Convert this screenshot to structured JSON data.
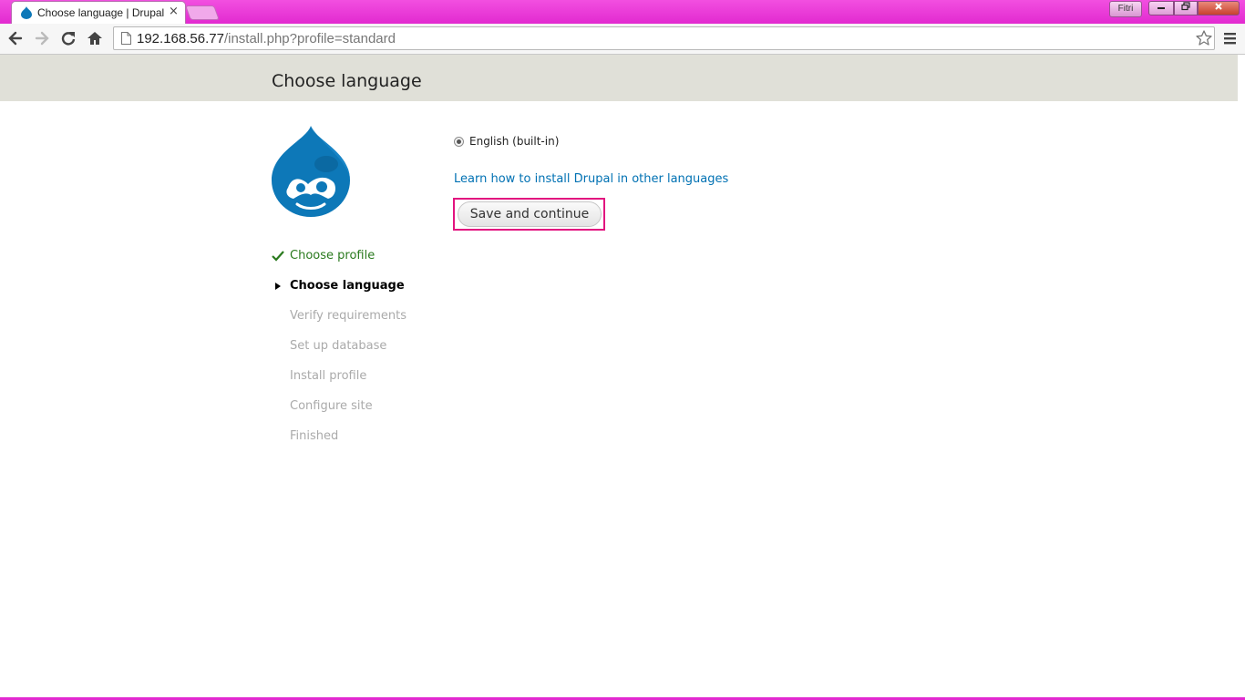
{
  "browser": {
    "tab_title": "Choose language | Drupal",
    "tab_close": "×",
    "user_badge": "Fitri",
    "url_host": "192.168.56.77",
    "url_path": "/install.php?profile=standard"
  },
  "page": {
    "title": "Choose language"
  },
  "steps": [
    {
      "label": "Choose profile",
      "state": "done"
    },
    {
      "label": "Choose language",
      "state": "active"
    },
    {
      "label": "Verify requirements",
      "state": "pending"
    },
    {
      "label": "Set up database",
      "state": "pending"
    },
    {
      "label": "Install profile",
      "state": "pending"
    },
    {
      "label": "Configure site",
      "state": "pending"
    },
    {
      "label": "Finished",
      "state": "pending"
    }
  ],
  "form": {
    "language_option": "English (built-in)",
    "language_selected": true,
    "learn_link": "Learn how to install Drupal in other languages",
    "submit_label": "Save and continue"
  },
  "colors": {
    "titlebar": "#e22ad0",
    "header_band": "#e0e0d8",
    "link": "#0071b3",
    "done_step": "#2a7a1e",
    "highlight_border": "#e2137f",
    "drupal_blue": "#0d78b8"
  }
}
